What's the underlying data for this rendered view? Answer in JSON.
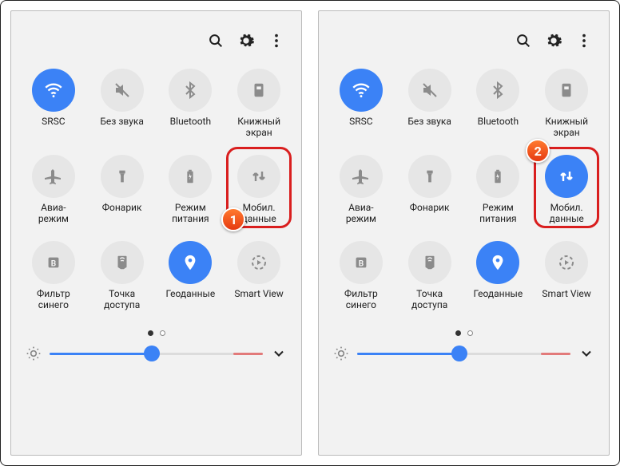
{
  "panels": [
    {
      "badge": "1",
      "tiles": [
        {
          "label": "SRSC",
          "icon": "wifi",
          "active": true
        },
        {
          "label": "Без звука",
          "icon": "mute",
          "active": false
        },
        {
          "label": "Bluetooth",
          "icon": "bluetooth",
          "active": false
        },
        {
          "label": "Книжный\nэкран",
          "icon": "book",
          "active": false
        },
        {
          "label": "Авиа-\nрежим",
          "icon": "airplane",
          "active": false
        },
        {
          "label": "Фонарик",
          "icon": "flashlight",
          "active": false
        },
        {
          "label": "Режим\nпитания",
          "icon": "battery",
          "active": false
        },
        {
          "label": "Мобил.\nданные",
          "icon": "data",
          "active": false,
          "highlight": true
        },
        {
          "label": "Фильтр\nсинего",
          "icon": "bluefilter",
          "active": false
        },
        {
          "label": "Точка\nдоступа",
          "icon": "hotspot",
          "active": false
        },
        {
          "label": "Геоданные",
          "icon": "location",
          "active": true
        },
        {
          "label": "Smart View",
          "icon": "smartview",
          "active": false
        }
      ]
    },
    {
      "badge": "2",
      "tiles": [
        {
          "label": "SRSC",
          "icon": "wifi",
          "active": true
        },
        {
          "label": "Без звука",
          "icon": "mute",
          "active": false
        },
        {
          "label": "Bluetooth",
          "icon": "bluetooth",
          "active": false
        },
        {
          "label": "Книжный\nэкран",
          "icon": "book",
          "active": false
        },
        {
          "label": "Авиа-\nрежим",
          "icon": "airplane",
          "active": false
        },
        {
          "label": "Фонарик",
          "icon": "flashlight",
          "active": false
        },
        {
          "label": "Режим\nпитания",
          "icon": "battery",
          "active": false
        },
        {
          "label": "Мобил.\nданные",
          "icon": "data",
          "active": true,
          "highlight": true
        },
        {
          "label": "Фильтр\nсинего",
          "icon": "bluefilter",
          "active": false
        },
        {
          "label": "Точка\nдоступа",
          "icon": "hotspot",
          "active": false
        },
        {
          "label": "Геоданные",
          "icon": "location",
          "active": true
        },
        {
          "label": "Smart View",
          "icon": "smartview",
          "active": false
        }
      ]
    }
  ],
  "brightness_pct": 48,
  "page_current": 1,
  "page_total": 2
}
